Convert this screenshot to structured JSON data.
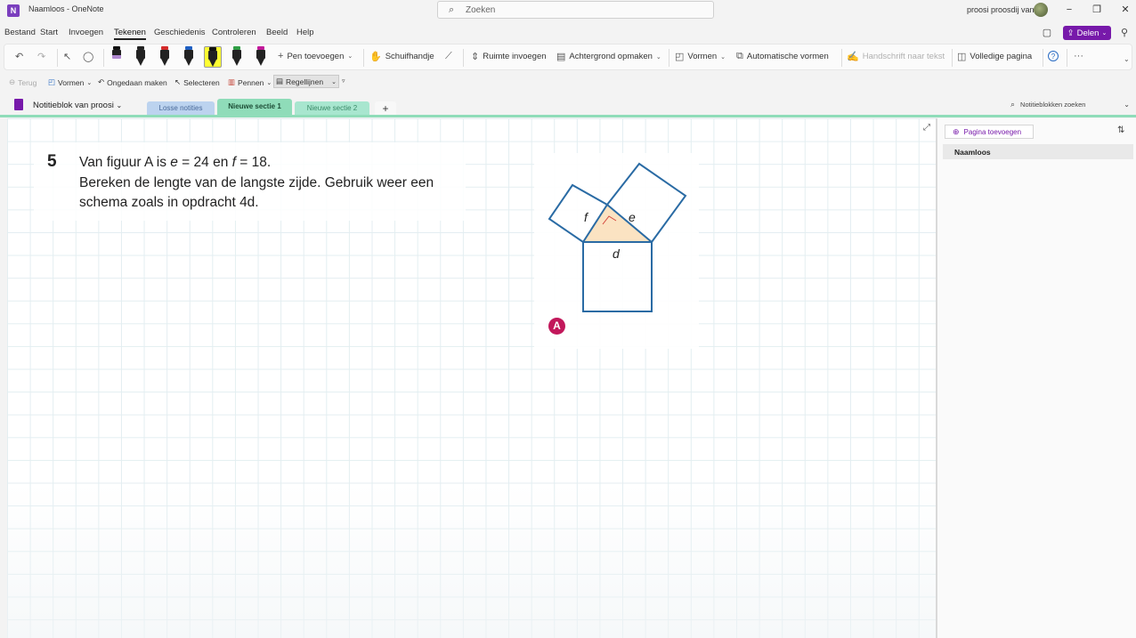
{
  "window": {
    "title": "Naamloos  -  OneNote",
    "search_placeholder": "Zoeken",
    "user": "proosi proosdij van"
  },
  "menu": {
    "items": [
      "Bestand",
      "Start",
      "Invoegen",
      "Tekenen",
      "Geschiedenis",
      "Controleren",
      "Beeld",
      "Help"
    ],
    "active": "Tekenen",
    "share_label": "Delen"
  },
  "ribbon": {
    "add_pen": "Pen toevoegen",
    "hand": "Schuifhandje",
    "insert_space": "Ruimte invoegen",
    "background": "Achtergrond opmaken",
    "shapes": "Vormen",
    "auto_shapes": "Automatische vormen",
    "ink_to_text": "Handschrift naar tekst",
    "full_page": "Volledige pagina",
    "pens": [
      {
        "name": "pen-purple",
        "color": "#b088d0"
      },
      {
        "name": "pen-black",
        "color": "#222222"
      },
      {
        "name": "pen-red",
        "color": "#d42a2a"
      },
      {
        "name": "pen-blue",
        "color": "#1e5fc2"
      },
      {
        "name": "highlighter-yellow",
        "color": "#ffff33"
      },
      {
        "name": "pen-green",
        "color": "#2e9e44"
      },
      {
        "name": "pen-magenta",
        "color": "#c2189a"
      }
    ]
  },
  "quick_toolbar": {
    "back": "Terug",
    "shapes": "Vormen",
    "undo": "Ongedaan maken",
    "select": "Selecteren",
    "pens": "Pennen",
    "rule_lines": "Regellijnen"
  },
  "notebook": {
    "name": "Notitieblok van proosi",
    "tabs": [
      {
        "label": "Losse notities",
        "color": "#bcd3ef"
      },
      {
        "label": "Nieuwe sectie 1",
        "color": "#8fdcb9"
      },
      {
        "label": "Nieuwe sectie 2",
        "color": "#a8e6cf"
      }
    ],
    "active_tab": "Nieuwe sectie 1",
    "search_placeholder": "Notitieblokken zoeken"
  },
  "page": {
    "question_number": "5",
    "line1_a": "Van figuur A is ",
    "line1_e": "e",
    "line1_b": " = 24 en ",
    "line1_f": "f",
    "line1_c": " = 18.",
    "line2": "Bereken de lengte van de langste zijde. Gebruik weer een",
    "line3": "schema zoals in opdracht 4d.",
    "figure": {
      "label_f": "f",
      "label_e": "e",
      "label_d": "d",
      "badge": "A",
      "stroke_color": "#2a6ba4",
      "fill_color": "#fbe3c2"
    }
  },
  "pages_pane": {
    "add_page": "Pagina toevoegen",
    "pages": [
      "Naamloos"
    ]
  }
}
